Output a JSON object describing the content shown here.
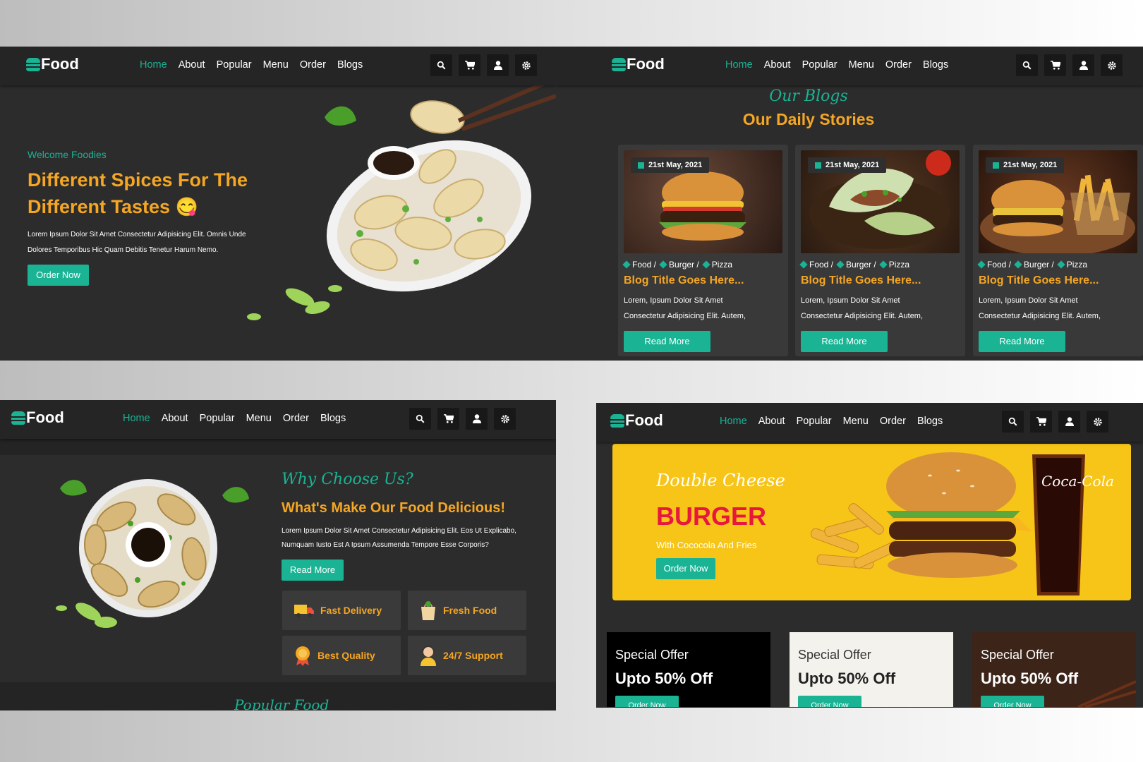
{
  "brand": "Food",
  "nav": {
    "items": [
      "Home",
      "About",
      "Popular",
      "Menu",
      "Order",
      "Blogs"
    ]
  },
  "icons": [
    "search-icon",
    "cart-icon",
    "user-icon",
    "gear-icon"
  ],
  "colors": {
    "accent": "#1ab394",
    "highlight": "#f5a623",
    "background": "#2c2c2c",
    "banner": "#f6c518",
    "burger_red": "#e8173d"
  },
  "hero": {
    "welcome": "Welcome Foodies",
    "heading_line1": "Different Spices For The",
    "heading_line2": "Different Tastes",
    "emoji": "😋",
    "body_line1": "Lorem Ipsum Dolor Sit Amet Consectetur Adipisicing Elit. Omnis Unde",
    "body_line2": "Dolores Temporibus Hic Quam Debitis Tenetur Harum Nemo.",
    "button": "Order Now"
  },
  "blogs": {
    "script_title": "Our Blogs",
    "title": "Our Daily Stories",
    "cards": [
      {
        "date": "21st May, 2021",
        "tags": [
          "Food /",
          "Burger /",
          "Pizza"
        ],
        "title": "Blog Title Goes Here...",
        "body_line1": "Lorem, Ipsum Dolor Sit Amet",
        "body_line2": "Consectetur Adipisicing Elit. Autem,",
        "button": "Read More"
      },
      {
        "date": "21st May, 2021",
        "tags": [
          "Food /",
          "Burger /",
          "Pizza"
        ],
        "title": "Blog Title Goes Here...",
        "body_line1": "Lorem, Ipsum Dolor Sit Amet",
        "body_line2": "Consectetur Adipisicing Elit. Autem,",
        "button": "Read More"
      },
      {
        "date": "21st May, 2021",
        "tags": [
          "Food /",
          "Burger /",
          "Pizza"
        ],
        "title": "Blog Title Goes Here...",
        "body_line1": "Lorem, Ipsum Dolor Sit Amet",
        "body_line2": "Consectetur Adipisicing Elit. Autem,",
        "button": "Read More"
      }
    ]
  },
  "why": {
    "script_title": "Why Choose Us?",
    "title": "What's Make Our Food Delicious!",
    "body_line1": "Lorem Ipsum Dolor Sit Amet Consectetur Adipisicing Elit. Eos Ut Explicabo,",
    "body_line2": "Numquam Iusto Est A Ipsum Assumenda Tempore Esse Corporis?",
    "button": "Read More",
    "features": [
      "Fast Delivery",
      "Fresh Food",
      "Best Quality",
      "24/7 Support"
    ],
    "next_section": "Popular Food"
  },
  "promo": {
    "script_title": "Double Cheese",
    "title": "BURGER",
    "subtitle": "With Cococola And Fries",
    "button": "Order Now",
    "cup_logo": "Coca-Cola"
  },
  "offers": [
    {
      "line1": "Special Offer",
      "line2": "Upto 50% Off",
      "button": "Order Now"
    },
    {
      "line1": "Special Offer",
      "line2": "Upto 50% Off",
      "button": "Order Now"
    },
    {
      "line1": "Special Offer",
      "line2": "Upto 50% Off",
      "button": "Order Now"
    }
  ]
}
